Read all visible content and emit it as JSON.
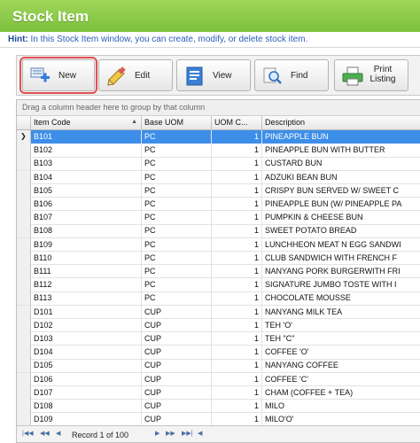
{
  "window": {
    "title": "Stock Item"
  },
  "hint": {
    "label": "Hint:",
    "text": " In this Stock Item window, you can create, modify, or delete stock item."
  },
  "toolbar": {
    "new_label": "New",
    "edit_label": "Edit",
    "view_label": "View",
    "find_label": "Find",
    "print_label_1": "Print",
    "print_label_2": "Listing"
  },
  "grid": {
    "group_hint": "Drag a column header here to group by that column",
    "columns": [
      "Item Code",
      "Base UOM",
      "UOM C...",
      "Description"
    ],
    "rows": [
      [
        "B101",
        "PC",
        "1",
        "PINEAPPLE BUN"
      ],
      [
        "B102",
        "PC",
        "1",
        "PINEAPPLE BUN WITH BUTTER"
      ],
      [
        "B103",
        "PC",
        "1",
        "CUSTARD BUN"
      ],
      [
        "B104",
        "PC",
        "1",
        "ADZUKI BEAN BUN"
      ],
      [
        "B105",
        "PC",
        "1",
        "CRISPY BUN SERVED W/ SWEET C"
      ],
      [
        "B106",
        "PC",
        "1",
        "PINEAPPLE BUN (W/ PINEAPPLE PA"
      ],
      [
        "B107",
        "PC",
        "1",
        "PUMPKIN & CHEESE BUN"
      ],
      [
        "B108",
        "PC",
        "1",
        "SWEET POTATO BREAD"
      ],
      [
        "B109",
        "PC",
        "1",
        "LUNCHHEON MEAT N EGG SANDWI"
      ],
      [
        "B110",
        "PC",
        "1",
        "CLUB SANDWICH WITH FRENCH F"
      ],
      [
        "B111",
        "PC",
        "1",
        "NANYANG PORK BURGERWITH FRI"
      ],
      [
        "B112",
        "PC",
        "1",
        "SIGNATURE JUMBO TOSTE WITH I"
      ],
      [
        "B113",
        "PC",
        "1",
        "CHOCOLATE MOUSSE"
      ],
      [
        "D101",
        "CUP",
        "1",
        "NANYANG MILK TEA"
      ],
      [
        "D102",
        "CUP",
        "1",
        "TEH 'O'"
      ],
      [
        "D103",
        "CUP",
        "1",
        "TEH \"C\""
      ],
      [
        "D104",
        "CUP",
        "1",
        "COFFEE 'O'"
      ],
      [
        "D105",
        "CUP",
        "1",
        "NANYANG COFFEE"
      ],
      [
        "D106",
        "CUP",
        "1",
        "COFFEE 'C'"
      ],
      [
        "D107",
        "CUP",
        "1",
        "CHAM (COFFEE + TEA)"
      ],
      [
        "D108",
        "CUP",
        "1",
        "MILO"
      ],
      [
        "D109",
        "CUP",
        "1",
        "MILO'O'"
      ]
    ],
    "selected_row": 0,
    "record_text": "Record 1 of 100"
  },
  "colors": {
    "title_green": "#7cc13c",
    "selection_blue": "#3d8ee8",
    "hint_blue": "#2a5db8"
  }
}
